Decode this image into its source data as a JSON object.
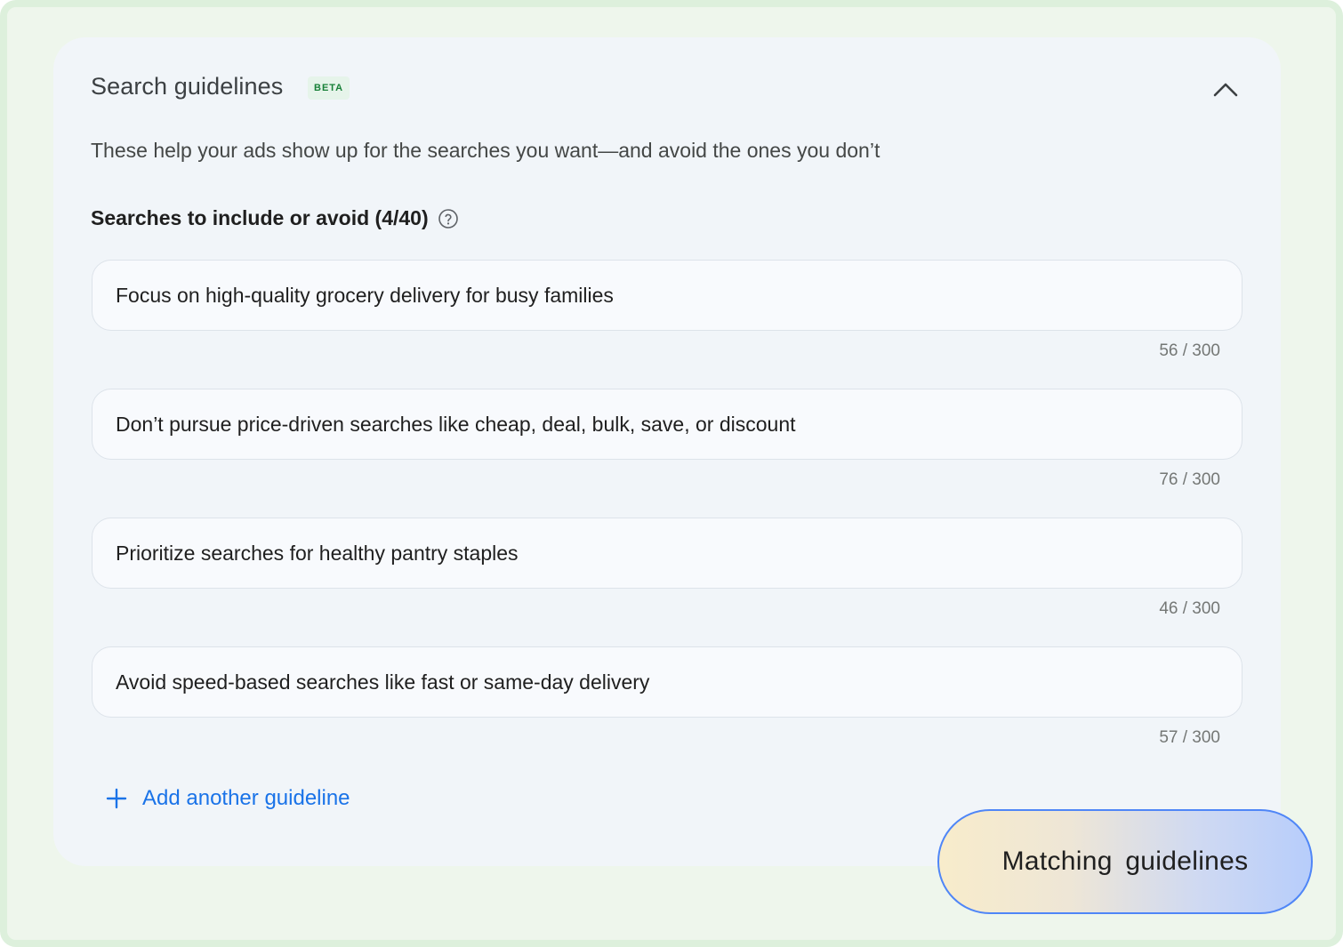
{
  "header": {
    "title": "Search guidelines",
    "badge": "BETA",
    "collapse_icon": "chevron-up-icon"
  },
  "description": "These help your ads show up for the searches you want—and avoid the ones you don’t",
  "section": {
    "label": "Searches to include or avoid (4/40)",
    "help_icon": "help-circle-icon"
  },
  "guidelines": [
    {
      "value": "Focus on high-quality grocery delivery for busy families",
      "counter": "56 / 300"
    },
    {
      "value": "Don’t pursue price-driven searches like cheap, deal, bulk, save, or discount",
      "counter": "76 / 300"
    },
    {
      "value": "Prioritize searches for healthy pantry staples",
      "counter": "46 / 300"
    },
    {
      "value": "Avoid speed-based searches like fast or same-day delivery",
      "counter": "57 / 300"
    }
  ],
  "add_guideline": {
    "label": "Add another guideline",
    "icon": "plus-icon"
  },
  "matching_pill": {
    "label": "Matching guidelines"
  },
  "colors": {
    "accent": "#1a73e8",
    "beta_text": "#188038",
    "beta_bg": "#e6f4ea",
    "frame": "#ddf0dc",
    "card_bg": "#f1f5f9"
  }
}
